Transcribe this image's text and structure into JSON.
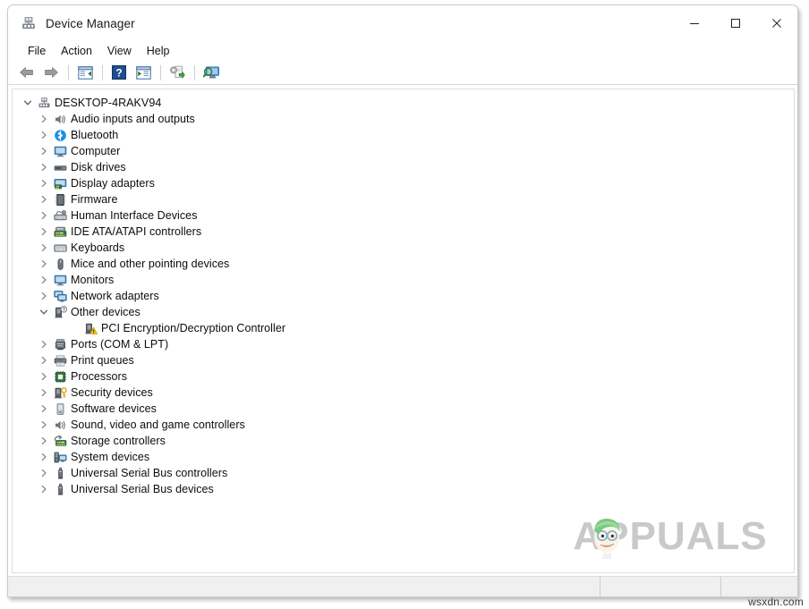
{
  "window": {
    "title": "Device Manager",
    "title_icon": "device-manager-icon",
    "controls": {
      "minimize": "minimize-icon",
      "maximize": "maximize-icon",
      "close": "close-icon"
    }
  },
  "menu": {
    "items": [
      {
        "label": "File",
        "name": "menu-file"
      },
      {
        "label": "Action",
        "name": "menu-action"
      },
      {
        "label": "View",
        "name": "menu-view"
      },
      {
        "label": "Help",
        "name": "menu-help"
      }
    ]
  },
  "toolbar": {
    "buttons": [
      {
        "name": "back-button",
        "icon": "back-arrow-icon",
        "tooltip": "Back"
      },
      {
        "name": "forward-button",
        "icon": "forward-arrow-icon",
        "tooltip": "Forward"
      },
      {
        "name": "separator-1",
        "icon": "separator"
      },
      {
        "name": "show-hide-console-tree-button",
        "icon": "console-tree-icon",
        "tooltip": "Show/Hide Console Tree"
      },
      {
        "name": "separator-2",
        "icon": "separator"
      },
      {
        "name": "help-button",
        "icon": "help-question-icon",
        "tooltip": "Help"
      },
      {
        "name": "properties-button",
        "icon": "properties-window-icon",
        "tooltip": "Properties"
      },
      {
        "name": "separator-3",
        "icon": "separator"
      },
      {
        "name": "update-driver-button",
        "icon": "update-driver-icon",
        "tooltip": "Update Driver Software"
      },
      {
        "name": "separator-4",
        "icon": "separator"
      },
      {
        "name": "scan-hardware-changes-button",
        "icon": "scan-hardware-icon",
        "tooltip": "Scan for hardware changes"
      }
    ]
  },
  "tree": {
    "root": {
      "label": "DESKTOP-4RAKV94",
      "icon": "computer-node-icon",
      "expanded": true,
      "chevron": "chevron-down-icon"
    },
    "nodes": [
      {
        "label": "Audio inputs and outputs",
        "icon": "speaker-icon",
        "expanded": false,
        "chevron": "chevron-right-icon",
        "level": 1
      },
      {
        "label": "Bluetooth",
        "icon": "bluetooth-icon",
        "expanded": false,
        "chevron": "chevron-right-icon",
        "level": 1
      },
      {
        "label": "Computer",
        "icon": "monitor-icon",
        "expanded": false,
        "chevron": "chevron-right-icon",
        "level": 1
      },
      {
        "label": "Disk drives",
        "icon": "disk-drive-icon",
        "expanded": false,
        "chevron": "chevron-right-icon",
        "level": 1
      },
      {
        "label": "Display adapters",
        "icon": "display-adapter-icon",
        "expanded": false,
        "chevron": "chevron-right-icon",
        "level": 1
      },
      {
        "label": "Firmware",
        "icon": "firmware-chip-icon",
        "expanded": false,
        "chevron": "chevron-right-icon",
        "level": 1
      },
      {
        "label": "Human Interface Devices",
        "icon": "hid-icon",
        "expanded": false,
        "chevron": "chevron-right-icon",
        "level": 1
      },
      {
        "label": "IDE ATA/ATAPI controllers",
        "icon": "ide-controller-icon",
        "expanded": false,
        "chevron": "chevron-right-icon",
        "level": 1
      },
      {
        "label": "Keyboards",
        "icon": "keyboard-icon",
        "expanded": false,
        "chevron": "chevron-right-icon",
        "level": 1
      },
      {
        "label": "Mice and other pointing devices",
        "icon": "mouse-icon",
        "expanded": false,
        "chevron": "chevron-right-icon",
        "level": 1
      },
      {
        "label": "Monitors",
        "icon": "monitor-icon",
        "expanded": false,
        "chevron": "chevron-right-icon",
        "level": 1
      },
      {
        "label": "Network adapters",
        "icon": "network-adapter-icon",
        "expanded": false,
        "chevron": "chevron-right-icon",
        "level": 1
      },
      {
        "label": "Other devices",
        "icon": "unknown-device-icon",
        "expanded": true,
        "chevron": "chevron-down-icon",
        "level": 1
      },
      {
        "label": "PCI Encryption/Decryption Controller",
        "icon": "warning-device-icon",
        "expanded": null,
        "chevron": "none",
        "level": 2
      },
      {
        "label": "Ports (COM & LPT)",
        "icon": "port-icon",
        "expanded": false,
        "chevron": "chevron-right-icon",
        "level": 1
      },
      {
        "label": "Print queues",
        "icon": "printer-icon",
        "expanded": false,
        "chevron": "chevron-right-icon",
        "level": 1
      },
      {
        "label": "Processors",
        "icon": "processor-icon",
        "expanded": false,
        "chevron": "chevron-right-icon",
        "level": 1
      },
      {
        "label": "Security devices",
        "icon": "security-key-icon",
        "expanded": false,
        "chevron": "chevron-right-icon",
        "level": 1
      },
      {
        "label": "Software devices",
        "icon": "software-device-icon",
        "expanded": false,
        "chevron": "chevron-right-icon",
        "level": 1
      },
      {
        "label": "Sound, video and game controllers",
        "icon": "speaker-icon",
        "expanded": false,
        "chevron": "chevron-right-icon",
        "level": 1
      },
      {
        "label": "Storage controllers",
        "icon": "storage-controller-icon",
        "expanded": false,
        "chevron": "chevron-right-icon",
        "level": 1
      },
      {
        "label": "System devices",
        "icon": "system-device-icon",
        "expanded": false,
        "chevron": "chevron-right-icon",
        "level": 1
      },
      {
        "label": "Universal Serial Bus controllers",
        "icon": "usb-icon",
        "expanded": false,
        "chevron": "chevron-right-icon",
        "level": 1
      },
      {
        "label": "Universal Serial Bus devices",
        "icon": "usb-icon",
        "expanded": false,
        "chevron": "chevron-right-icon",
        "level": 1
      }
    ]
  },
  "statusbar": {
    "pane1": "",
    "pane2": "",
    "pane3": ""
  },
  "watermark": {
    "brand": "APPUALS",
    "mascot": "appuals-mascot-icon",
    "source_text": "wsxdn.com"
  },
  "colors": {
    "window_bg": "#ffffff",
    "frame_border": "#c9c9c9",
    "toolbar_border": "#d8d8d8",
    "statusbar_bg": "#f0f0f0",
    "text": "#0c0c0c",
    "bluetooth_blue": "#1a8fe0",
    "warning_yellow": "#f5c518",
    "accent_green": "#4caf50",
    "watermark_gray": "#c6c6c6",
    "mascot_hair_green": "#72c472"
  }
}
